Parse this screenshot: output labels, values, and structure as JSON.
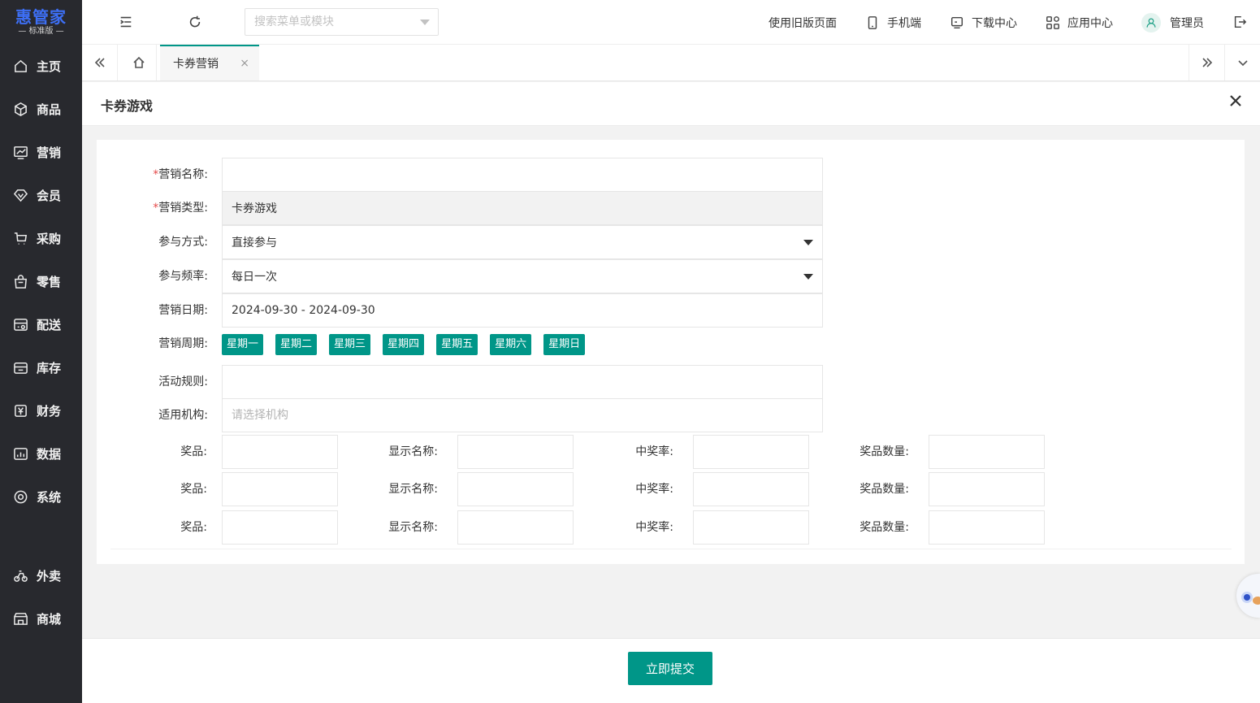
{
  "app": {
    "logo_main": "惠管家",
    "logo_sub": "— 标准版 —"
  },
  "sidebar": {
    "items": [
      {
        "label": "主页",
        "icon": "home-icon"
      },
      {
        "label": "商品",
        "icon": "box-icon"
      },
      {
        "label": "营销",
        "icon": "trend-chart-icon"
      },
      {
        "label": "会员",
        "icon": "diamond-icon"
      },
      {
        "label": "采购",
        "icon": "cart-icon"
      },
      {
        "label": "零售",
        "icon": "shopping-bag-icon"
      },
      {
        "label": "配送",
        "icon": "delivery-icon"
      },
      {
        "label": "库存",
        "icon": "storage-icon"
      },
      {
        "label": "财务",
        "icon": "yuan-icon"
      },
      {
        "label": "数据",
        "icon": "bar-chart-icon"
      },
      {
        "label": "系统",
        "icon": "settings-icon"
      },
      {
        "label": "外卖",
        "icon": "bike-icon"
      },
      {
        "label": "商城",
        "icon": "store-icon"
      }
    ]
  },
  "topbar": {
    "search_placeholder": "搜索菜单或模块",
    "old_version": "使用旧版页面",
    "mobile": "手机端",
    "download": "下载中心",
    "apps": "应用中心",
    "user": "管理员"
  },
  "tabs": {
    "active_label": "卡券营销",
    "close_glyph": "×"
  },
  "panel": {
    "title": "卡券游戏",
    "close_glyph": "✕"
  },
  "form": {
    "name_label": "营销名称:",
    "name_value": "",
    "type_label": "营销类型:",
    "type_value": "卡券游戏",
    "mode_label": "参与方式:",
    "mode_value": "直接参与",
    "freq_label": "参与频率:",
    "freq_value": "每日一次",
    "date_label": "营销日期:",
    "date_value": "2024-09-30 - 2024-09-30",
    "cycle_label": "营销周期:",
    "weekdays": [
      "星期一",
      "星期二",
      "星期三",
      "星期四",
      "星期五",
      "星期六",
      "星期日"
    ],
    "rule_label": "活动规则:",
    "rule_value": "",
    "org_label": "适用机构:",
    "org_placeholder": "请选择机构",
    "required_mark": "*",
    "prize_label": "奖品:",
    "display_label": "显示名称:",
    "rate_label": "中奖率:",
    "qty_label": "奖品数量:"
  },
  "footer": {
    "submit_label": "立即提交"
  },
  "colors": {
    "accent": "#009688",
    "sidebar_bg": "#28292e",
    "logo_blue": "#3d6ff5",
    "required_red": "#e54a4a"
  }
}
